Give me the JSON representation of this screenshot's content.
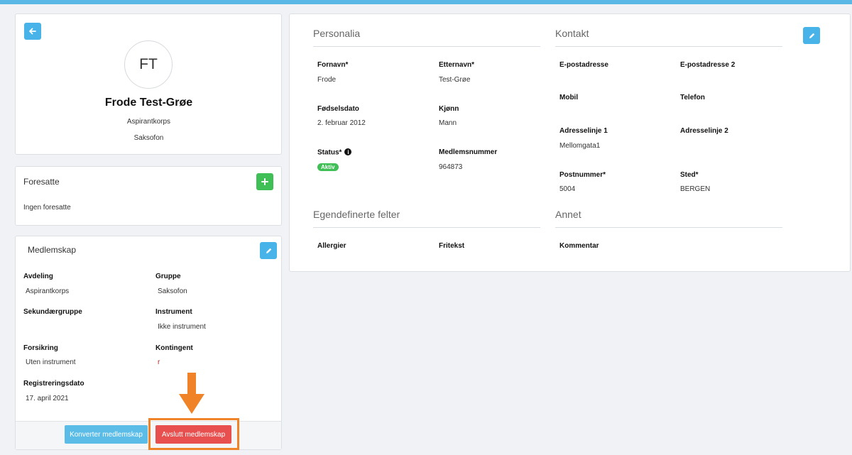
{
  "profile": {
    "initials": "FT",
    "name": "Frode Test-Grøe",
    "division": "Aspirantkorps",
    "group": "Saksofon"
  },
  "guardians": {
    "title": "Foresatte",
    "empty_text": "Ingen foresatte"
  },
  "membership": {
    "title": "Medlemskap",
    "fields": {
      "avdeling_label": "Avdeling",
      "avdeling_value": "Aspirantkorps",
      "gruppe_label": "Gruppe",
      "gruppe_value": "Saksofon",
      "sekundaer_label": "Sekundærgruppe",
      "sekundaer_value": "",
      "instrument_label": "Instrument",
      "instrument_value": "Ikke instrument",
      "forsikring_label": "Forsikring",
      "forsikring_value": "Uten instrument",
      "kontingent_label": "Kontingent",
      "kontingent_value": "r",
      "registrering_label": "Registreringsdato",
      "registrering_value": "17. april 2021"
    },
    "convert_button": "Konverter medlemskap",
    "end_button": "Avslutt medlemskap"
  },
  "personalia": {
    "title": "Personalia",
    "fornavn_label": "Fornavn*",
    "fornavn_value": "Frode",
    "etternavn_label": "Etternavn*",
    "etternavn_value": "Test-Grøe",
    "fodselsdato_label": "Fødselsdato",
    "fodselsdato_value": "2. februar 2012",
    "kjonn_label": "Kjønn",
    "kjonn_value": "Mann",
    "status_label": "Status*",
    "status_value": "Aktiv",
    "medlemsnummer_label": "Medlemsnummer",
    "medlemsnummer_value": "964873"
  },
  "kontakt": {
    "title": "Kontakt",
    "epost_label": "E-postadresse",
    "epost2_label": "E-postadresse 2",
    "mobil_label": "Mobil",
    "telefon_label": "Telefon",
    "adresse1_label": "Adresselinje 1",
    "adresse1_value": "Mellomgata1",
    "adresse2_label": "Adresselinje 2",
    "postnummer_label": "Postnummer*",
    "postnummer_value": "5004",
    "sted_label": "Sted*",
    "sted_value": "BERGEN"
  },
  "egendefinerte": {
    "title": "Egendefinerte felter",
    "allergier_label": "Allergier",
    "fritekst_label": "Fritekst"
  },
  "annet": {
    "title": "Annet",
    "kommentar_label": "Kommentar"
  },
  "colors": {
    "accent": "#48b3e8",
    "success": "#3fbf55",
    "danger": "#e8504f",
    "highlight": "#f08328"
  }
}
